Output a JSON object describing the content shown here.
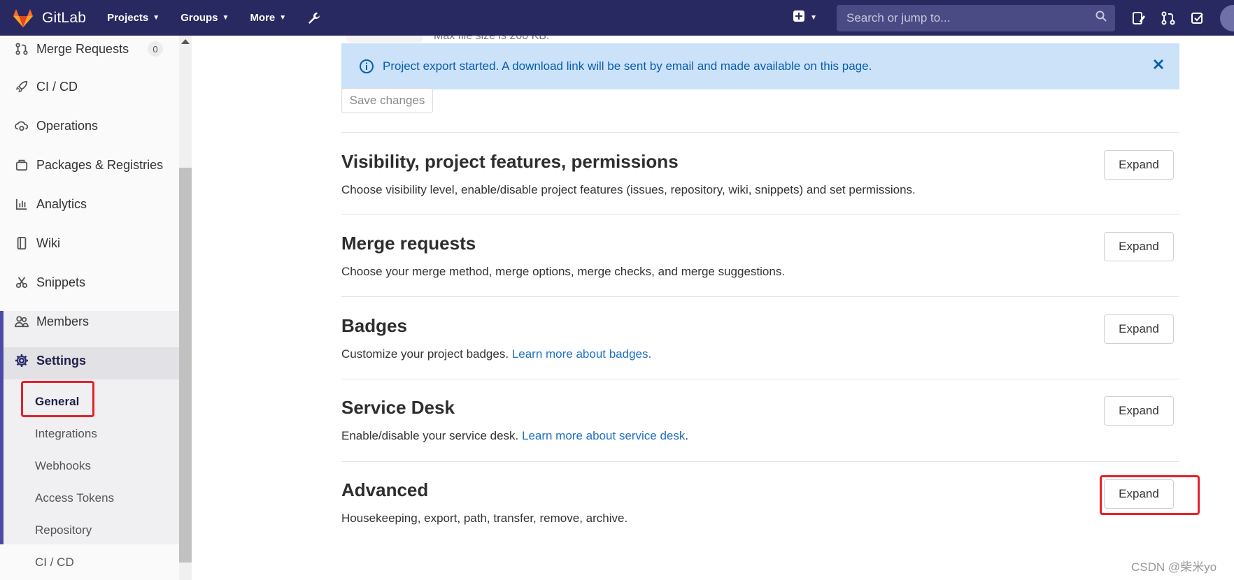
{
  "app": {
    "name": "GitLab"
  },
  "topnav": {
    "menus": [
      {
        "label": "Projects"
      },
      {
        "label": "Groups"
      },
      {
        "label": "More"
      }
    ],
    "search_placeholder": "Search or jump to..."
  },
  "sidebar": {
    "items": [
      {
        "label": "Merge Requests",
        "icon": "merge-request-icon",
        "count": "0"
      },
      {
        "label": "CI / CD",
        "icon": "rocket-icon"
      },
      {
        "label": "Operations",
        "icon": "cloud-gear-icon"
      },
      {
        "label": "Packages & Registries",
        "icon": "package-icon"
      },
      {
        "label": "Analytics",
        "icon": "chart-icon"
      },
      {
        "label": "Wiki",
        "icon": "book-icon"
      },
      {
        "label": "Snippets",
        "icon": "scissors-icon"
      },
      {
        "label": "Members",
        "icon": "users-icon"
      },
      {
        "label": "Settings",
        "icon": "gear-icon"
      }
    ],
    "settings_sub": [
      {
        "label": "General"
      },
      {
        "label": "Integrations"
      },
      {
        "label": "Webhooks"
      },
      {
        "label": "Access Tokens"
      },
      {
        "label": "Repository"
      },
      {
        "label": "CI / CD"
      }
    ]
  },
  "main": {
    "partial_text": "Max file size is 200 KB.",
    "alert": "Project export started. A download link will be sent by email and made available on this page.",
    "save_button": "Save changes",
    "sections": [
      {
        "title": "Visibility, project features, permissions",
        "desc": "Choose visibility level, enable/disable project features (issues, repository, wiki, snippets) and set permissions.",
        "button": "Expand"
      },
      {
        "title": "Merge requests",
        "desc": "Choose your merge method, merge options, merge checks, and merge suggestions.",
        "button": "Expand"
      },
      {
        "title": "Badges",
        "desc": "Customize your project badges.",
        "link": "Learn more about badges.",
        "button": "Expand"
      },
      {
        "title": "Service Desk",
        "desc": "Enable/disable your service desk.",
        "link": "Learn more about service desk",
        "desc_tail": ".",
        "button": "Expand"
      },
      {
        "title": "Advanced",
        "desc": "Housekeeping, export, path, transfer, remove, archive.",
        "button": "Expand"
      }
    ]
  },
  "watermark": "CSDN @柴米yo",
  "colors": {
    "nav_bg": "#292961",
    "alert_bg": "#cbe2f9",
    "link": "#1f6fc5",
    "highlight": "#e8202a"
  }
}
